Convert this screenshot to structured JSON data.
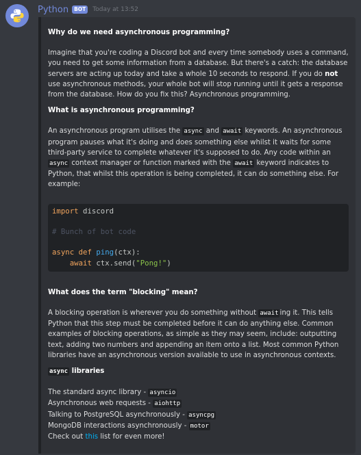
{
  "author": {
    "name": "Python",
    "tag": "BOT",
    "timestamp": "Today at 13:52",
    "avatar_icon": "python-logo"
  },
  "colors": {
    "username": "#7289da",
    "bot_tag_bg": "#7289da",
    "link": "#00b0f4",
    "embed_bg": "#2f3136",
    "background": "#36393f"
  },
  "embed": {
    "h1": "Why do we need asynchronous programming?",
    "p1_a": "Imagine that you're coding a Discord bot and every time somebody uses a command, you need to get some information from a database. But there's a catch: the database servers are acting up today and take a whole 10 seconds to respond. If you do ",
    "p1_not": "not",
    "p1_b": " use asynchronous methods, your whole bot will stop running until it gets a response from the database. How do you fix this? Asynchronous programming.",
    "h2": "What is asynchronous programming?",
    "p2_a": "An asynchronous program utilises the ",
    "p2_code1": "async",
    "p2_b": " and ",
    "p2_code2": "await",
    "p2_c": " keywords. An asynchronous program pauses what it's doing and does something else whilst it waits for some third-party service to complete whatever it's supposed to do. Any code within an ",
    "p2_code3": "async",
    "p2_d": " context manager or function marked with the ",
    "p2_code4": "await",
    "p2_e": " keyword indicates to Python, that whilst this operation is being completed, it can do something else. For example:",
    "code": {
      "l1_kw": "import",
      "l1_tx": " discord",
      "l3_cm": "# Bunch of bot code",
      "l5_kw1": "async",
      "l5_kw2": " def ",
      "l5_fn": "ping",
      "l5_tx": "(ctx):",
      "l6_kw": "    await",
      "l6_tx1": " ctx.send(",
      "l6_st": "\"Pong!\"",
      "l6_tx2": ")"
    },
    "h3": "What does the term \"blocking\" mean?",
    "p3_a": "A blocking operation is wherever you do something without ",
    "p3_code": "await",
    "p3_b": "ing it. This tells Python that this step must be completed before it can do anything else. Common examples of blocking operations, as simple as they may seem, include: outputting text, adding two numbers and appending an item onto a list. Most common Python libraries have an asynchronous version available to use in asynchronous contexts.",
    "h4_code": "async",
    "h4_text": " libraries",
    "libs": [
      {
        "text": "The standard async library - ",
        "code": "asyncio"
      },
      {
        "text": "Asynchronous web requests - ",
        "code": "aiohttp"
      },
      {
        "text": "Talking to PostgreSQL asynchronously - ",
        "code": "asyncpg"
      },
      {
        "text": "MongoDB interactions asynchronously - ",
        "code": "motor"
      }
    ],
    "last_a": "Check out ",
    "last_link": "this",
    "last_b": " list for even more!"
  }
}
